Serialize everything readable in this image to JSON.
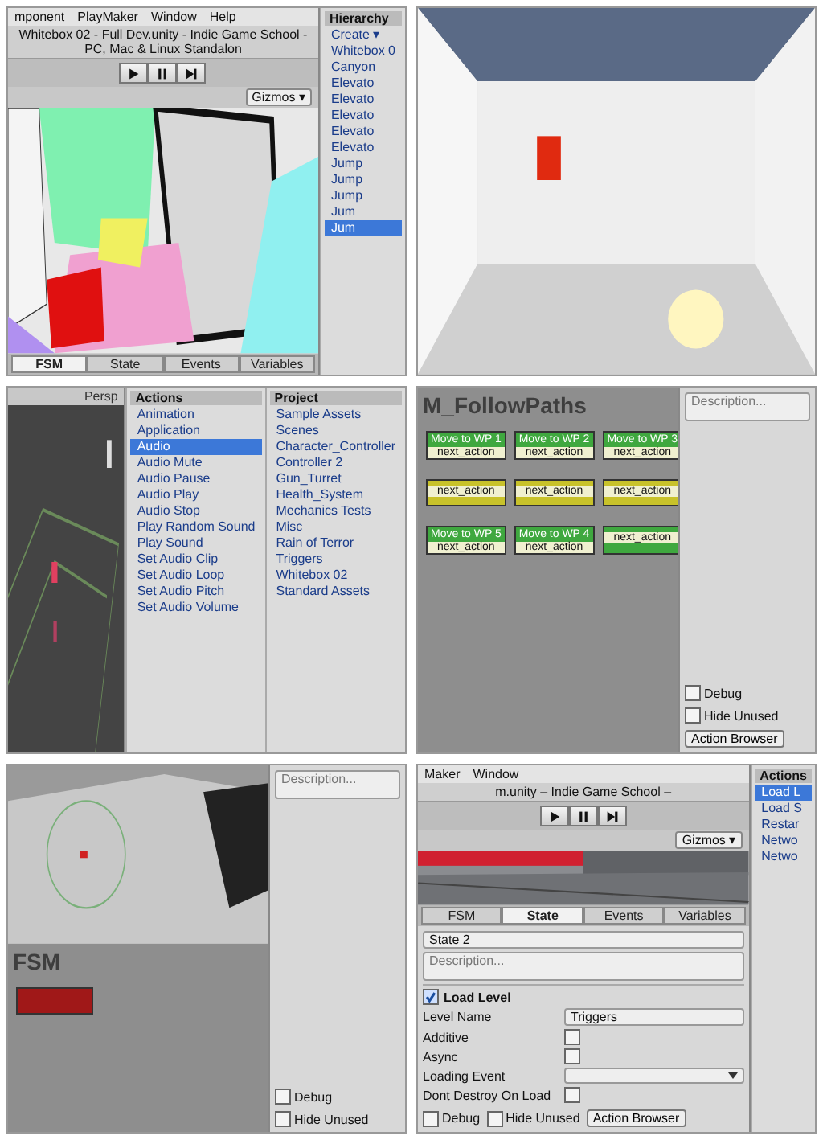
{
  "panels": [
    {
      "main": [
        {
          "kind": "menubar",
          "items": [
            "mponent",
            "PlayMaker",
            "Window",
            "Help"
          ]
        },
        {
          "kind": "titlebar",
          "text": "Whitebox 02 - Full Dev.unity - Indie Game School - PC, Mac & Linux Standalon"
        },
        {
          "kind": "playbar"
        },
        {
          "kind": "wireframe",
          "gizmos": "Gizmos ▾"
        },
        {
          "kind": "tabs",
          "tabs": [
            {
              "label": "FSM",
              "selected": true
            },
            {
              "label": "State",
              "selected": false
            },
            {
              "label": "Events",
              "selected": false
            },
            {
              "label": "Variables",
              "selected": false
            }
          ]
        }
      ],
      "side": [
        {
          "kind": "list",
          "title": "Hierarchy",
          "items": [
            {
              "text": "Create ▾",
              "selected": false
            },
            {
              "text": "Whitebox 0",
              "selected": false
            },
            {
              "text": "Canyon",
              "selected": false
            },
            {
              "text": "Elevato",
              "selected": false
            },
            {
              "text": "Elevato",
              "selected": false
            },
            {
              "text": "Elevato",
              "selected": false
            },
            {
              "text": "Elevato",
              "selected": false
            },
            {
              "text": "Elevato",
              "selected": false
            },
            {
              "text": "Jump",
              "selected": false
            },
            {
              "text": "Jump",
              "selected": false
            },
            {
              "text": "Jump",
              "selected": false
            },
            {
              "text": "Jum",
              "selected": false
            },
            {
              "text": "Jum",
              "selected": true
            }
          ]
        }
      ]
    },
    {
      "main": [
        {
          "kind": "room"
        }
      ]
    },
    {
      "main": [
        {
          "kind": "grid",
          "label": "Persp"
        }
      ],
      "side": [
        {
          "kind": "list",
          "title": "Actions",
          "items": [
            {
              "text": "Animation",
              "selected": false
            },
            {
              "text": "Application",
              "selected": false
            },
            {
              "text": "Audio",
              "selected": true
            },
            {
              "text": "Audio Mute",
              "selected": false
            },
            {
              "text": "Audio Pause",
              "selected": false
            },
            {
              "text": "Audio Play",
              "selected": false
            },
            {
              "text": "Audio Stop",
              "selected": false
            },
            {
              "text": "Play Random Sound",
              "selected": false
            },
            {
              "text": "Play Sound",
              "selected": false
            },
            {
              "text": "Set Audio Clip",
              "selected": false
            },
            {
              "text": "Set Audio Loop",
              "selected": false
            },
            {
              "text": "Set Audio Pitch",
              "selected": false
            },
            {
              "text": "Set Audio Volume",
              "selected": false
            }
          ]
        },
        {
          "kind": "list",
          "title": "Project",
          "items": [
            {
              "text": "Sample Assets",
              "selected": false
            },
            {
              "text": "Scenes",
              "selected": false
            },
            {
              "text": "Character_Controller",
              "selected": false
            },
            {
              "text": "Controller 2",
              "selected": false
            },
            {
              "text": "Gun_Turret",
              "selected": false
            },
            {
              "text": "Health_System",
              "selected": false
            },
            {
              "text": "Mechanics Tests",
              "selected": false
            },
            {
              "text": "Misc",
              "selected": false
            },
            {
              "text": "Rain of Terror",
              "selected": false
            },
            {
              "text": "Triggers",
              "selected": false
            },
            {
              "text": "Whitebox 02",
              "selected": false
            },
            {
              "text": "Standard Assets",
              "selected": false
            }
          ]
        }
      ]
    },
    {
      "main": [
        {
          "kind": "graph",
          "title": "M_FollowPaths",
          "nodes": [
            {
              "label": "Move to WP 1",
              "sub": "next_action",
              "color": "#3fa83f"
            },
            {
              "label": "Move to WP 2",
              "sub": "next_action",
              "color": "#3fa83f"
            },
            {
              "label": "Move to WP 3",
              "sub": "next_action",
              "color": "#3fa83f"
            },
            {
              "sub": "next_action",
              "color": "#c8c22a"
            },
            {
              "sub": "next_action",
              "color": "#c8c22a"
            },
            {
              "sub": "next_action",
              "color": "#c8c22a"
            },
            {
              "label": "Move to WP 5",
              "sub": "next_action",
              "color": "#3fa83f"
            },
            {
              "label": "Move to WP 4",
              "sub": "next_action",
              "color": "#3fa83f"
            },
            {
              "sub": "next_action",
              "color": "#3fa83f"
            }
          ]
        }
      ],
      "side": [
        {
          "kind": "inspector",
          "description": "Description...",
          "footer": [
            {
              "kind": "check",
              "label": "Debug",
              "checked": false
            },
            {
              "kind": "check",
              "label": "Hide Unused",
              "checked": false
            },
            {
              "kind": "button",
              "label": "Action Browser"
            }
          ]
        }
      ]
    },
    {
      "main": [
        {
          "kind": "floor"
        },
        {
          "kind": "graph",
          "title": "FSM",
          "nodes": [
            {
              "color": "#a01818"
            }
          ]
        }
      ],
      "side": [
        {
          "kind": "inspector",
          "description": "Description...",
          "footer": [
            {
              "kind": "check",
              "label": "Debug",
              "checked": false
            },
            {
              "kind": "check",
              "label": "Hide Unused",
              "checked": false
            }
          ]
        }
      ]
    },
    {
      "main": [
        {
          "kind": "menubar",
          "items": [
            "Maker",
            "Window"
          ]
        },
        {
          "kind": "titlebar",
          "text": "m.unity – Indie Game School –"
        },
        {
          "kind": "playbar"
        },
        {
          "kind": "arena",
          "gizmos": "Gizmos ▾"
        },
        {
          "kind": "tabs",
          "tabs": [
            {
              "label": "FSM",
              "selected": false
            },
            {
              "label": "State",
              "selected": true
            },
            {
              "label": "Events",
              "selected": false
            },
            {
              "label": "Variables",
              "selected": false
            }
          ]
        },
        {
          "kind": "inspector",
          "state": "State 2",
          "description": "Description...",
          "action": {
            "label": "Load Level",
            "checked": true
          },
          "rows": [
            {
              "label": "Level Name",
              "kind": "text",
              "value": "Triggers"
            },
            {
              "label": "Additive",
              "kind": "check",
              "checked": false
            },
            {
              "label": "Async",
              "kind": "check",
              "checked": false
            },
            {
              "label": "Loading Event",
              "kind": "select"
            },
            {
              "label": "Dont Destroy On Load",
              "kind": "check",
              "checked": false
            }
          ],
          "footer": [
            {
              "kind": "check",
              "label": "Debug",
              "checked": false
            },
            {
              "kind": "check",
              "label": "Hide Unused",
              "checked": false
            },
            {
              "kind": "button",
              "label": "Action Browser"
            }
          ]
        }
      ],
      "side": [
        {
          "kind": "list",
          "title": "Actions",
          "items": [
            {
              "text": "Load L",
              "selected": true
            },
            {
              "text": "Load S",
              "selected": false
            },
            {
              "text": "Restar",
              "selected": false
            },
            {
              "text": "Netwo",
              "selected": false
            },
            {
              "text": "Netwo",
              "selected": false
            }
          ]
        }
      ]
    }
  ]
}
